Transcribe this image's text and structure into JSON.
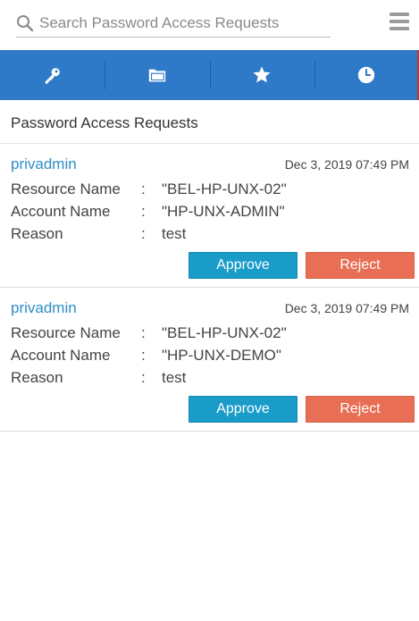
{
  "search": {
    "placeholder": "Search Password Access Requests"
  },
  "tabs": [
    {
      "icon": "key-icon"
    },
    {
      "icon": "folder-icon"
    },
    {
      "icon": "star-icon"
    },
    {
      "icon": "clock-icon"
    }
  ],
  "colors": {
    "tab_bar": "#2f7ac8",
    "approve": "#1a9cc9",
    "reject": "#e86f55",
    "username": "#2c8ec6"
  },
  "section": {
    "title": "Password Access Requests"
  },
  "labels": {
    "resource": "Resource Name",
    "account": "Account Name",
    "reason": "Reason",
    "colon": ":",
    "approve": "Approve",
    "reject": "Reject"
  },
  "requests": [
    {
      "user": "privadmin",
      "date": "Dec 3, 2019 07:49 PM",
      "resource": "\"BEL-HP-UNX-02\"",
      "account": "\"HP-UNX-ADMIN\"",
      "reason": "test"
    },
    {
      "user": "privadmin",
      "date": "Dec 3, 2019 07:49 PM",
      "resource": "\"BEL-HP-UNX-02\"",
      "account": "\"HP-UNX-DEMO\"",
      "reason": "test"
    }
  ]
}
